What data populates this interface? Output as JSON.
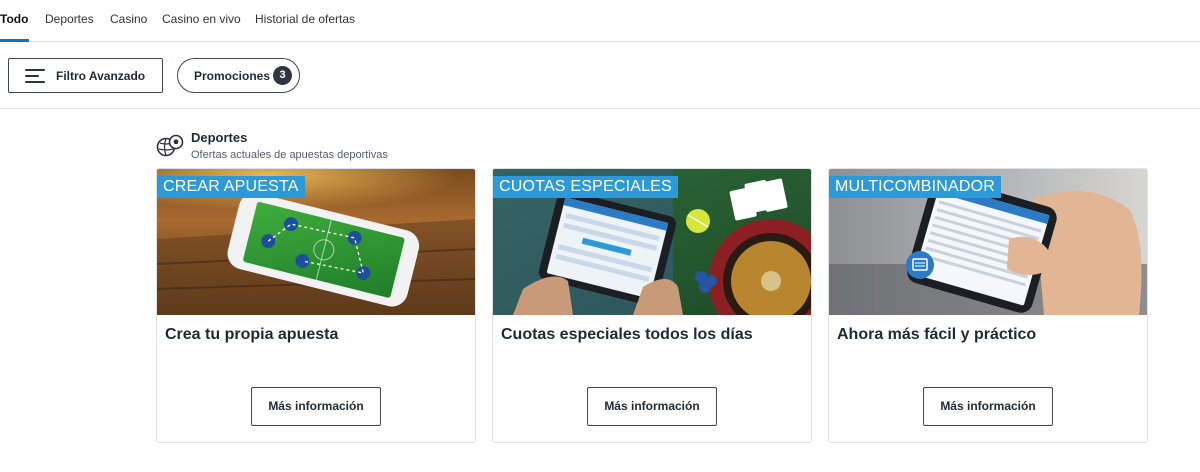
{
  "tabs": [
    {
      "label": "Todo",
      "active": true
    },
    {
      "label": "Deportes",
      "active": false
    },
    {
      "label": "Casino",
      "active": false
    },
    {
      "label": "Casino en vivo",
      "active": false
    },
    {
      "label": "Historial de ofertas",
      "active": false
    }
  ],
  "filters": {
    "advanced_label": "Filtro Avanzado",
    "promotions_label": "Promociones",
    "promotions_count": "3"
  },
  "section": {
    "icon": "sports-balls-icon",
    "title": "Deportes",
    "subtitle": "Ofertas actuales de apuestas deportivas"
  },
  "cards": [
    {
      "tag": "CREAR APUESTA",
      "title": "Crea tu propia apuesta",
      "button": "Más información",
      "image": "phone-bet-builder-image"
    },
    {
      "tag": "CUOTAS ESPECIALES",
      "title": "Cuotas especiales todos los días",
      "button": "Más información",
      "image": "tablet-roulette-image"
    },
    {
      "tag": "MULTICOMBINADOR",
      "title": "Ahora más fácil y práctico",
      "button": "Más información",
      "image": "hand-phone-image"
    }
  ],
  "colors": {
    "accent": "#1e6fb6",
    "tag_bg": "#2c9ad9",
    "text": "#1f2a33",
    "badge_bg": "#2c3741"
  }
}
